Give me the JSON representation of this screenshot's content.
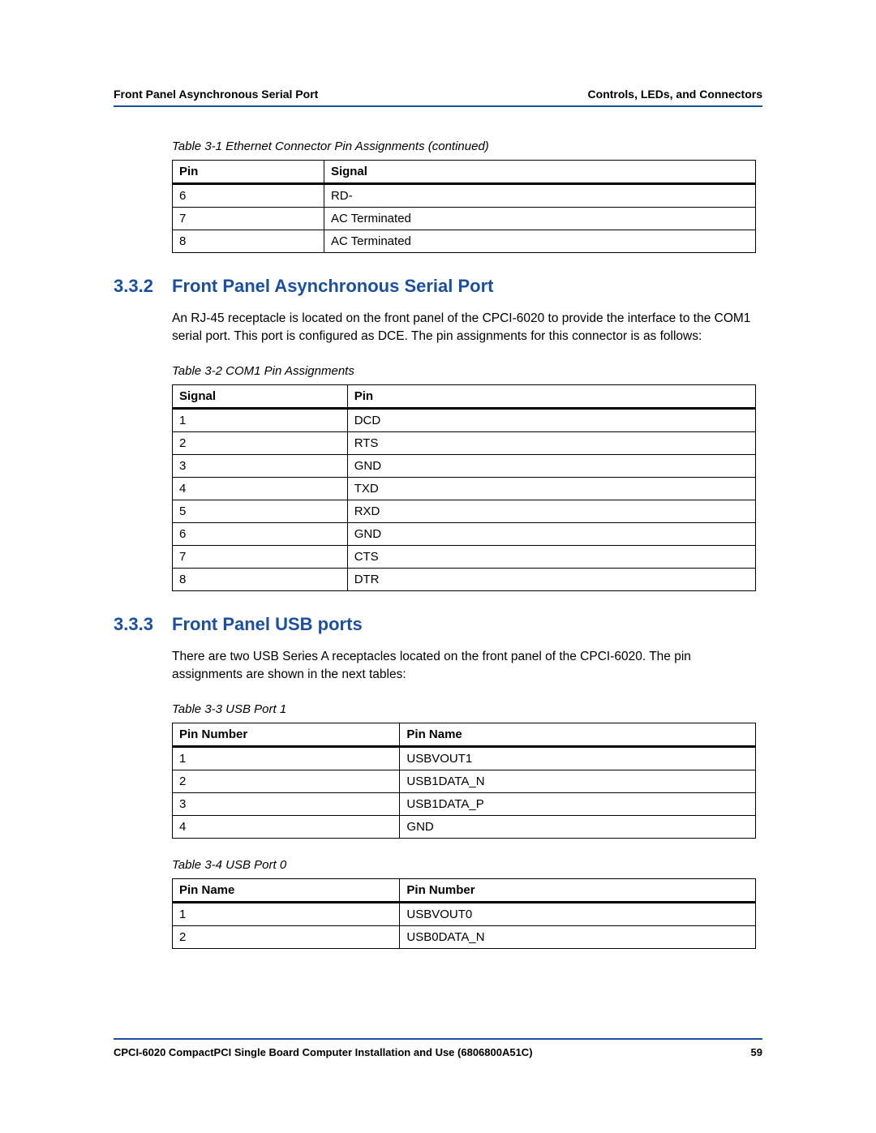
{
  "header": {
    "left": "Front Panel Asynchronous Serial Port",
    "right": "Controls, LEDs, and Connectors"
  },
  "table1": {
    "caption": "Table 3-1 Ethernet Connector Pin Assignments (continued)",
    "col1": "Pin",
    "col2": "Signal",
    "rows": [
      {
        "c1": "6",
        "c2": "RD-"
      },
      {
        "c1": "7",
        "c2": "AC Terminated"
      },
      {
        "c1": "8",
        "c2": "AC Terminated"
      }
    ]
  },
  "section332": {
    "num": "3.3.2",
    "title": "Front Panel Asynchronous Serial Port",
    "body": "An RJ-45 receptacle is located on the front panel of the CPCI-6020 to provide the interface to the COM1 serial port. This port is configured as DCE. The pin assignments for this connector is as follows:"
  },
  "table2": {
    "caption": "Table 3-2 COM1 Pin Assignments",
    "col1": "Signal",
    "col2": "Pin",
    "rows": [
      {
        "c1": "1",
        "c2": "DCD"
      },
      {
        "c1": "2",
        "c2": "RTS"
      },
      {
        "c1": "3",
        "c2": "GND"
      },
      {
        "c1": "4",
        "c2": "TXD"
      },
      {
        "c1": "5",
        "c2": "RXD"
      },
      {
        "c1": "6",
        "c2": "GND"
      },
      {
        "c1": "7",
        "c2": "CTS"
      },
      {
        "c1": "8",
        "c2": "DTR"
      }
    ]
  },
  "section333": {
    "num": "3.3.3",
    "title": "Front Panel USB ports",
    "body": "There are two USB Series A receptacles located on the front panel of the CPCI-6020. The pin assignments are shown in the next tables:"
  },
  "table3": {
    "caption": "Table 3-3 USB Port 1",
    "col1": "Pin Number",
    "col2": "Pin Name",
    "rows": [
      {
        "c1": "1",
        "c2": "USBVOUT1"
      },
      {
        "c1": "2",
        "c2": "USB1DATA_N"
      },
      {
        "c1": "3",
        "c2": "USB1DATA_P"
      },
      {
        "c1": "4",
        "c2": "GND"
      }
    ]
  },
  "table4": {
    "caption": "Table 3-4 USB Port 0",
    "col1": "Pin Name",
    "col2": "Pin Number",
    "rows": [
      {
        "c1": "1",
        "c2": "USBVOUT0"
      },
      {
        "c1": "2",
        "c2": "USB0DATA_N"
      }
    ]
  },
  "footer": {
    "left": "CPCI-6020 CompactPCI Single Board Computer Installation and Use (6806800A51C)",
    "right": "59"
  },
  "col_widths": {
    "twoColNarrow": [
      "26%",
      "74%"
    ],
    "twoColWide": [
      "30%",
      "70%"
    ],
    "twoColHalf": [
      "39%",
      "61%"
    ]
  }
}
